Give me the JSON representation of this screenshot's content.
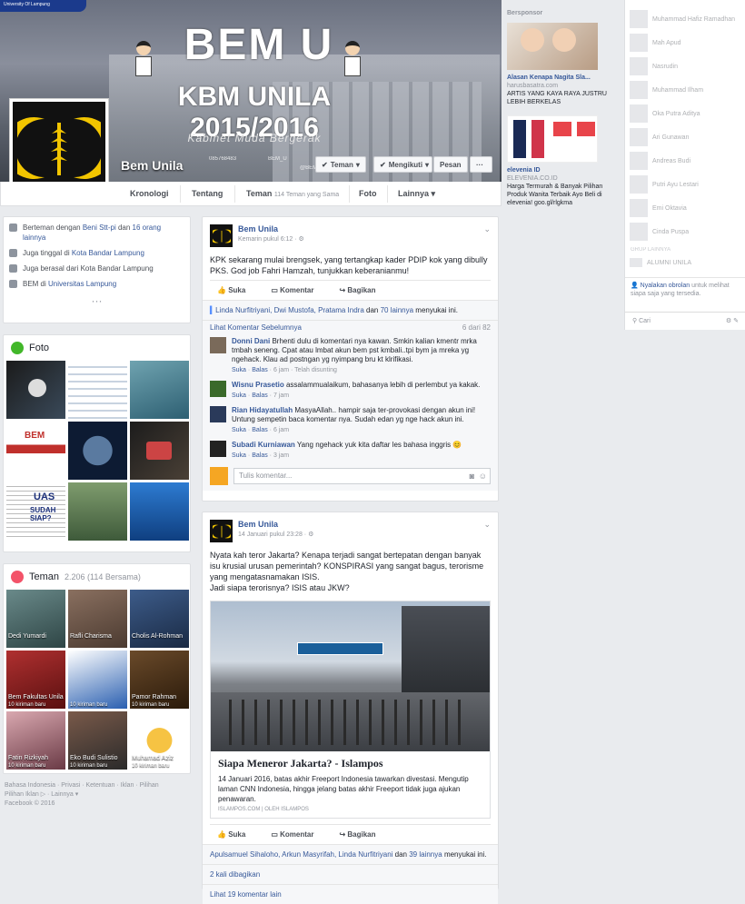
{
  "cover": {
    "university_badge": "University Of Lampung",
    "title": "BEM U",
    "subtitle": "KBM UNILA 2015/2016",
    "tagline": "Kabinet Muda Bergerak",
    "info_phone": "085768483",
    "info_twitter": "BEM_U",
    "info_ig": "@BEMU"
  },
  "page": {
    "name": "Bem Unila",
    "buttons": {
      "friends": "Teman",
      "following": "Mengikuti",
      "message": "Pesan",
      "more": "···"
    }
  },
  "tabs": {
    "timeline": "Kronologi",
    "about": "Tentang",
    "friends": "Teman",
    "friends_count": "114 Teman yang Sama",
    "photos": "Foto",
    "more": "Lainnya"
  },
  "about": {
    "r1_pre": "Berteman dengan ",
    "r1_link": "Beni Stt-pi",
    "r1_mid": " dan ",
    "r1_link2": "16 orang lainnya",
    "r2_pre": "Juga tinggal di ",
    "r2_link": "Kota Bandar Lampung",
    "r3": "Juga berasal dari Kota Bandar Lampung",
    "r4_pre": "BEM di ",
    "r4_link": "Universitas Lampung",
    "more": "···"
  },
  "photos": {
    "title": "Foto",
    "tile_text_1": "BEM",
    "tile_text_2": "UAS",
    "tile_text_3": "SUDAH SIAP?"
  },
  "friends": {
    "title": "Teman",
    "count": "2.206 (114 Bersama)",
    "items": [
      {
        "name": "Dedi Yumardi",
        "sub": ""
      },
      {
        "name": "Rafli Charisma",
        "sub": ""
      },
      {
        "name": "Cholis Al-Rohman",
        "sub": ""
      },
      {
        "name": "Bem Fakultas Unila",
        "sub": "10 kiriman baru"
      },
      {
        "name": "",
        "sub": "10 kiriman baru"
      },
      {
        "name": "Pamor Rahman",
        "sub": "10 kiriman baru"
      },
      {
        "name": "Fatin Rizkiyah",
        "sub": "10 kiriman baru"
      },
      {
        "name": "Eko Budi Sulistio",
        "sub": "10 kiriman baru"
      },
      {
        "name": "Muhamad Aziz",
        "sub": "10 kiriman baru"
      }
    ]
  },
  "footer": {
    "line1": "Bahasa Indonesia · Privasi · Ketentuan · Iklan · Pilihan",
    "line2": "Pilihan Iklan ▷ · Lainnya ▾",
    "line3": "Facebook © 2016"
  },
  "post1": {
    "author": "Bem Unila",
    "time": "Kemarin pukul 6:12 · ",
    "text": "KPK sekarang mulai brengsek, yang tertangkap kader PDIP kok yang dibully PKS. God job Fahri Hamzah, tunjukkan keberanianmu!",
    "like": "Suka",
    "comment": "Komentar",
    "share": "Bagikan",
    "likes_names": "Linda Nurfitriyani, Dwi Mustofa, Pratama Indra",
    "likes_mid": " dan ",
    "likes_others": "70 lainnya",
    "likes_suffix": " menyukai ini.",
    "prev_comments": "Lihat Komentar Sebelumnya",
    "comment_count": "6 dari 82",
    "comments": [
      {
        "name": "Donni Dani",
        "text": "Brhenti dulu di komentari nya kawan. Smkin kalian kmentr mrka tmbah seneng. Cpat atau lmbat akun bem pst kmbali..tpi bym ja mreka yg ngehack. Klau ad postngan yg nyimpang bru kt klrifikasi.",
        "meta_like": "Suka",
        "meta_reply": "Balas",
        "meta_time": "6 jam · Telah disunting"
      },
      {
        "name": "Wisnu Prasetio",
        "text": "assalammualaikum, bahasanya lebih di perlembut ya kakak.",
        "meta_like": "Suka",
        "meta_reply": "Balas",
        "meta_time": "7 jam"
      },
      {
        "name": "Rian Hidayatullah",
        "text": "MasyaAllah.. hampir saja ter-provokasi dengan akun ini! Untung sempetin baca komentar nya. Sudah edan yg nge hack akun ini.",
        "meta_like": "Suka",
        "meta_reply": "Balas",
        "meta_time": "6 jam"
      },
      {
        "name": "Subadi Kurniawan",
        "text": "Yang ngehack yuk kita daftar les bahasa inggris 😊",
        "meta_like": "Suka",
        "meta_reply": "Balas",
        "meta_time": "3 jam"
      }
    ],
    "comment_placeholder": "Tulis komentar..."
  },
  "post2": {
    "author": "Bem Unila",
    "time": "14 Januari pukul 23:28 · ",
    "text": "Nyata kah teror Jakarta? Kenapa terjadi sangat bertepatan dengan banyak isu krusial urusan pemerintah? KONSPIRASI yang sangat bagus, terorisme yang mengatasnamakan ISIS.",
    "text2": "Jadi siapa terorisnya? ISIS atau JKW?",
    "link_title": "Siapa Meneror Jakarta? - Islampos",
    "link_desc": "14 Januari 2016, batas akhir Freeport Indonesia tawarkan divestasi. Mengutip laman CNN Indonesia, hingga jelang batas akhir Freeport tidak juga ajukan penawaran.",
    "link_domain": "ISLAMPOS.COM | OLEH ISLAMPOS",
    "like": "Suka",
    "comment": "Komentar",
    "share": "Bagikan",
    "likes_names": "Apulsamuel Sihaloho, Arkun Masyrifah, Linda Nurfitriyani",
    "likes_mid": " dan ",
    "likes_others": "39 lainnya",
    "likes_suffix": " menyukai ini.",
    "shares": "2 kali dibagikan",
    "view_comments": "Lihat 19 komentar lain"
  },
  "sponsored": {
    "title": "Bersponsor",
    "ad1_title": "Alasan Kenapa Nagita Sla...",
    "ad1_domain": "harusbasatra.com",
    "ad1_text": "ARTIS YANG KAYA RAYA JUSTRU LEBIH BERKELAS",
    "ad2_title": "elevenia ID",
    "ad2_domain": "ELEVENIA.CO.ID",
    "ad2_text": "Harga Termurah & Banyak Pilihan Produk Wanita Terbaik Ayo Beli di elevenia! goo.gl/rlgkma"
  },
  "chat": {
    "contacts": [
      "Muhammad Hafiz Ramadhan",
      "Mah Apud",
      "Nasrudin",
      "Muhammad Ilham",
      "Oka Putra Aditya",
      "Ari Gunawan",
      "Andreas Budi",
      "Putri Ayu Lestari",
      "Emi Oktavia",
      "Cinda Puspa"
    ],
    "group_label": "GRUP LAINNYA",
    "group_item": "ALUMNI UNILA",
    "suggest_link": "Nyalakan obrolan",
    "suggest_text": " untuk melihat siapa saja yang tersedia.",
    "search_placeholder": "Cari"
  },
  "colors": {
    "fb_blue": "#365899",
    "bg": "#e9ebee",
    "photo_icon": "#42b72a",
    "friends_icon": "#f35369"
  }
}
